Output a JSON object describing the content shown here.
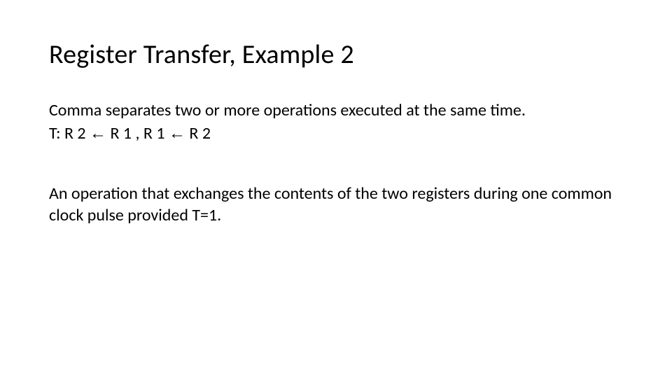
{
  "title": "Register Transfer, Example 2",
  "paragraph1": "Comma separates two or more operations executed at the same time.",
  "formula": {
    "prefix": "T: R 2 ",
    "arrow1": "←",
    "mid1": " R 1 , R 1 ",
    "arrow2": "←",
    "suffix": " R 2"
  },
  "paragraph2": "An operation that exchanges the contents of the two registers during one common clock pulse provided T=1."
}
